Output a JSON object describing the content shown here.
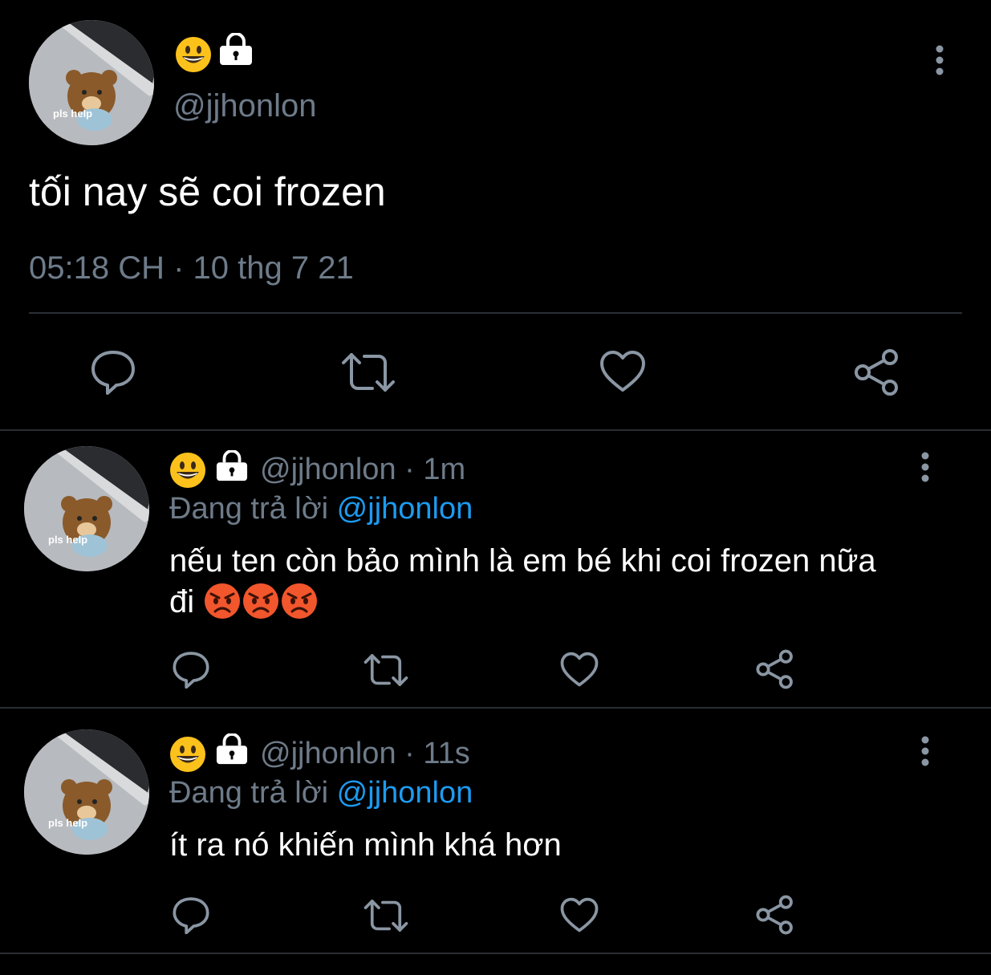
{
  "main_tweet": {
    "handle": "@jjhonlon",
    "avatar_caption": "pls help",
    "text": "tối nay sẽ coi frozen",
    "timestamp": "05:18 CH · 10 thg 7 21"
  },
  "replies": [
    {
      "handle_time": "@jjhonlon · 1m",
      "replying_prefix": "Đang trả lời",
      "replying_to": "@jjhonlon",
      "avatar_caption": "pls help",
      "text_line1": "nếu ten còn bảo mình là em bé khi coi frozen nữa",
      "text_line2": "đi"
    },
    {
      "handle_time": "@jjhonlon · 11s",
      "replying_prefix": "Đang trả lời",
      "replying_to": "@jjhonlon",
      "avatar_caption": "pls help",
      "text_line1": "ít ra nó khiến mình khá hơn"
    }
  ],
  "icons": [
    "grinning-emoji",
    "lock-icon",
    "more-vertical-icon",
    "reply-icon",
    "retweet-icon",
    "like-icon",
    "share-icon",
    "angry-emoji"
  ],
  "colors": {
    "background": "#000000",
    "muted": "#6e7b89",
    "link": "#1d9bf0",
    "divider": "#2a2e33"
  }
}
